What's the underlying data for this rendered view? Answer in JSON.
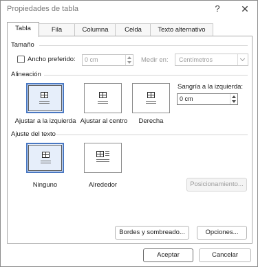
{
  "window": {
    "title": "Propiedades de tabla",
    "help_glyph": "?",
    "close_glyph": "✕"
  },
  "tabs": [
    {
      "label": "Tabla",
      "active": true
    },
    {
      "label": "Fila",
      "active": false
    },
    {
      "label": "Columna",
      "active": false
    },
    {
      "label": "Celda",
      "active": false
    },
    {
      "label": "Texto alternativo",
      "active": false
    }
  ],
  "size": {
    "section_label": "Tamaño",
    "preferred_width_label": "Ancho preferido:",
    "preferred_width_checked": false,
    "preferred_width_value": "0 cm",
    "measure_in_label": "Medir en:",
    "measure_in_value": "Centímetros"
  },
  "alignment": {
    "section_label": "Alineación",
    "options": [
      {
        "label": "Ajustar a la izquierda",
        "selected": true
      },
      {
        "label": "Ajustar al centro",
        "selected": false
      },
      {
        "label": "Derecha",
        "selected": false
      }
    ],
    "indent_label": "Sangría a la izquierda:",
    "indent_value": "0 cm"
  },
  "text_wrapping": {
    "section_label": "Ajuste del texto",
    "options": [
      {
        "label": "Ninguno",
        "selected": true
      },
      {
        "label": "Alrededor",
        "selected": false
      }
    ],
    "positioning_button": "Posicionamiento..."
  },
  "buttons": {
    "borders": "Bordes y sombreado...",
    "options": "Opciones...",
    "accept": "Aceptar",
    "cancel": "Cancelar"
  },
  "colors": {
    "accent": "#4a78c2",
    "selected_bg": "#e6eefa"
  },
  "icons": {
    "help": "question-mark-icon",
    "close": "close-icon",
    "dropdown": "chevron-down-icon",
    "table_align_left": "table-align-left-icon",
    "table_align_center": "table-align-center-icon",
    "table_align_right": "table-align-right-icon",
    "wrap_none": "table-wrap-none-icon",
    "wrap_around": "table-wrap-around-icon"
  }
}
